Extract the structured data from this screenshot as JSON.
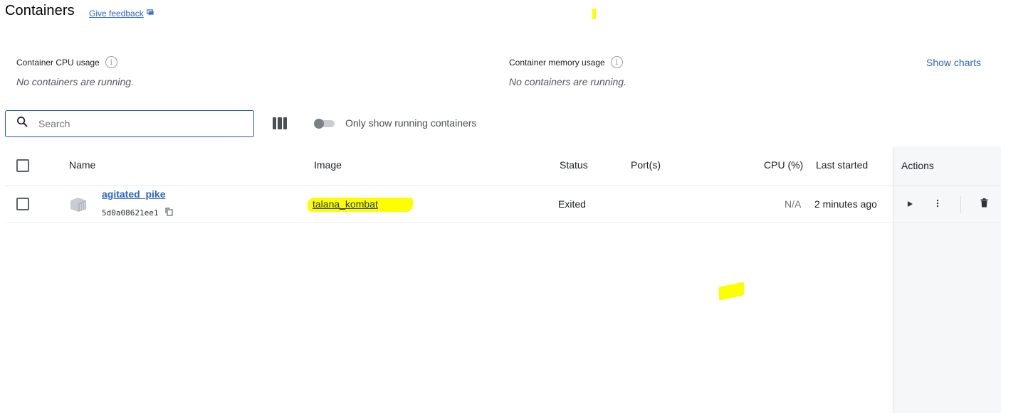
{
  "header": {
    "title": "Containers",
    "feedback_label": "Give feedback"
  },
  "stats": {
    "cpu_label": "Container CPU usage",
    "cpu_empty": "No containers are running.",
    "memory_label": "Container memory usage",
    "memory_empty": "No containers are running.",
    "info_glyph": "i",
    "show_charts_label": "Show charts"
  },
  "toolbar": {
    "search_placeholder": "Search",
    "search_value": "",
    "only_running_label": "Only show running containers",
    "only_running_on": false
  },
  "table": {
    "columns": {
      "name": "Name",
      "image": "Image",
      "status": "Status",
      "ports": "Port(s)",
      "cpu": "CPU (%)",
      "last_started": "Last started",
      "actions": "Actions"
    },
    "rows": [
      {
        "name": "agitated_pike",
        "id": "5d0a08621ee1",
        "image": "talana_kombat",
        "status": "Exited",
        "ports": "",
        "cpu": "N/A",
        "last_started": "2 minutes ago"
      }
    ]
  },
  "colors": {
    "accent": "#2c64c8",
    "highlight": "#fbff00",
    "search_border": "#1f56c0"
  },
  "icons": [
    "feedback-icon",
    "info-icon",
    "search-icon",
    "columns-icon",
    "container-icon",
    "copy-icon",
    "play-icon",
    "more-vertical-icon",
    "trash-icon"
  ]
}
